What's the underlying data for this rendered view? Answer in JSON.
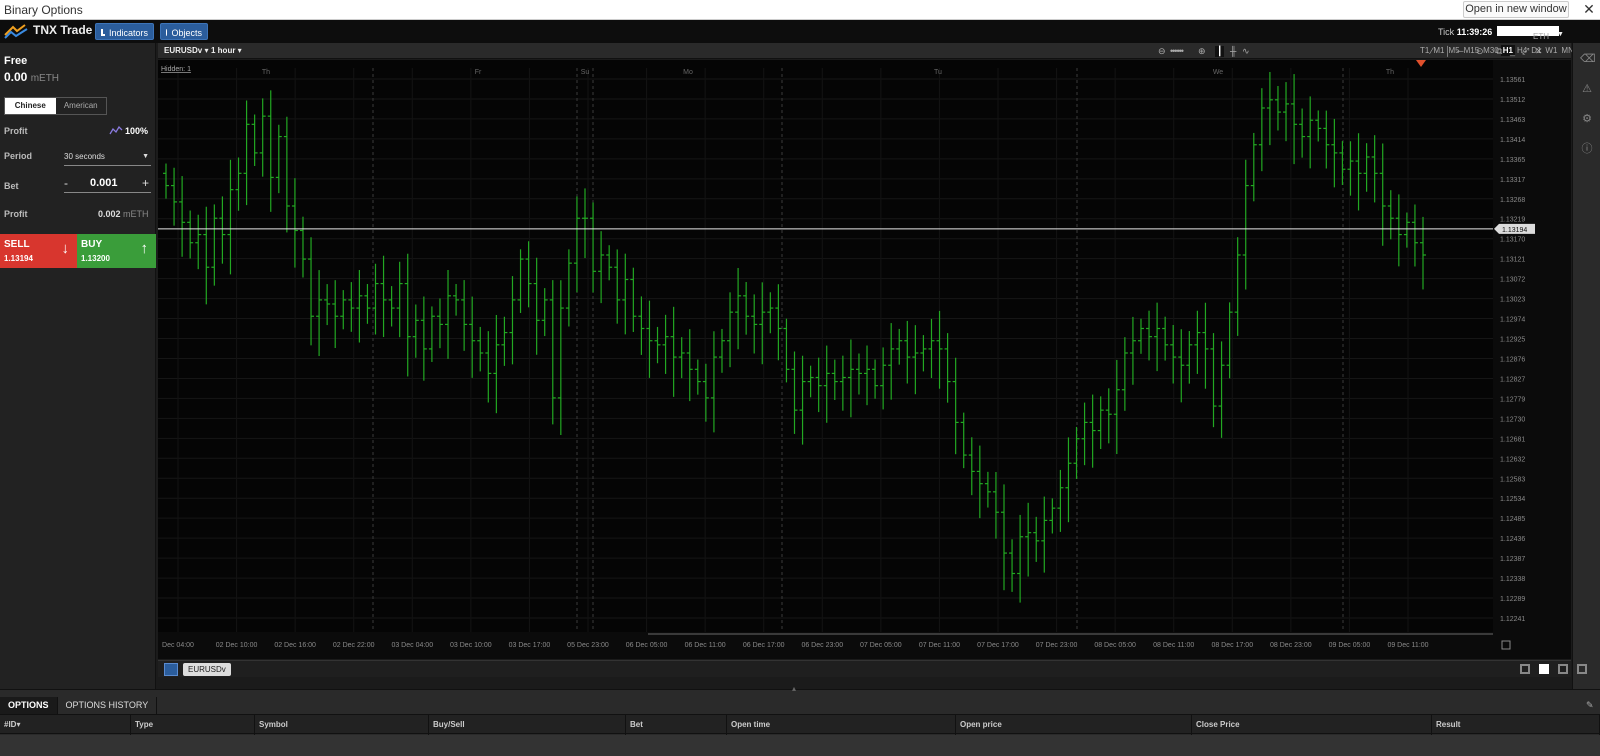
{
  "window": {
    "title": "Binary Options",
    "open_new_window": "Open in new window"
  },
  "header": {
    "brand": "TNX Trade",
    "indicators_label": "Indicators",
    "objects_label": "Objects",
    "tick_label": "Tick",
    "tick_time": "11:39:26",
    "account_currency": "ETH"
  },
  "left_panel": {
    "free_label": "Free",
    "free_value": "0.00",
    "free_unit": "mETH",
    "mode_tabs": [
      "Chinese",
      "American"
    ],
    "active_mode": "Chinese",
    "profit_label": "Profit",
    "profit_pct": "100%",
    "period_label": "Period",
    "period_value": "30 seconds",
    "bet_label": "Bet",
    "bet_minus": "-",
    "bet_value": "0.001",
    "bet_plus": "+",
    "profit2_label": "Profit",
    "profit2_value": "0.002",
    "profit2_unit": "mETH",
    "sell_label": "SELL",
    "sell_price": "1.13194",
    "buy_label": "BUY",
    "buy_price": "1.13200",
    "sell_color": "#d8362e",
    "buy_color": "#3a9d3a"
  },
  "chart_toolbar": {
    "symbol": "EURUSDv",
    "period": "1 hour",
    "timeframes": [
      "T1",
      "M1",
      "M5",
      "M15",
      "M30",
      "H1",
      "H4",
      "D1",
      "W1",
      "MN1"
    ],
    "active_timeframe": "H1"
  },
  "chart_data": {
    "type": "ohlc",
    "hidden_label": "Hidden: 1",
    "day_labels": [
      "Th",
      "Fr",
      "Su",
      "Mo",
      "Tu",
      "We",
      "Th"
    ],
    "x_tick_labels": [
      "Dec 04:00",
      "02 Dec 10:00",
      "02 Dec 16:00",
      "02 Dec 22:00",
      "03 Dec 04:00",
      "03 Dec 10:00",
      "03 Dec 17:00",
      "05 Dec 23:00",
      "06 Dec 05:00",
      "06 Dec 11:00",
      "06 Dec 17:00",
      "06 Dec 23:00",
      "07 Dec 05:00",
      "07 Dec 11:00",
      "07 Dec 17:00",
      "07 Dec 23:00",
      "08 Dec 05:00",
      "08 Dec 11:00",
      "08 Dec 17:00",
      "08 Dec 23:00",
      "09 Dec 05:00",
      "09 Dec 11:00"
    ],
    "y_tick_labels": [
      "1.13561",
      "1.13512",
      "1.13463",
      "1.13414",
      "1.13365",
      "1.13317",
      "1.13268",
      "1.13219",
      "1.13170",
      "1.13121",
      "1.13072",
      "1.13023",
      "1.12974",
      "1.12925",
      "1.12876",
      "1.12827",
      "1.12779",
      "1.12730",
      "1.12681",
      "1.12632",
      "1.12583",
      "1.12534",
      "1.12485",
      "1.12436",
      "1.12387",
      "1.12338",
      "1.12289",
      "1.12241"
    ],
    "ylim": [
      1.12241,
      1.13561
    ],
    "current_price": "1.13194",
    "bar_color": "#22a822",
    "price_line_color": "#e6e6e6",
    "closes": [
      1.133,
      1.1326,
      1.1321,
      1.1316,
      1.1318,
      1.131,
      1.1322,
      1.1318,
      1.1329,
      1.1333,
      1.1345,
      1.1338,
      1.1347,
      1.1332,
      1.1342,
      1.1325,
      1.1319,
      1.1312,
      1.1298,
      1.1302,
      1.1301,
      1.1298,
      1.1302,
      1.13,
      1.1303,
      1.13,
      1.1306,
      1.1302,
      1.13,
      1.1306,
      1.1293,
      1.1297,
      1.129,
      1.1298,
      1.1296,
      1.1303,
      1.1302,
      1.1296,
      1.1292,
      1.1289,
      1.1284,
      1.1291,
      1.1294,
      1.1302,
      1.1312,
      1.1306,
      1.1297,
      1.1302,
      1.1278,
      1.13,
      1.1311,
      1.1322,
      1.1322,
      1.1309,
      1.1313,
      1.131,
      1.1302,
      1.1307,
      1.1298,
      1.1295,
      1.1292,
      1.1291,
      1.1293,
      1.1288,
      1.1289,
      1.1285,
      1.1282,
      1.1278,
      1.1288,
      1.1292,
      1.1299,
      1.1303,
      1.1298,
      1.1296,
      1.1299,
      1.13,
      1.1295,
      1.1285,
      1.1275,
      1.1282,
      1.1283,
      1.1281,
      1.1284,
      1.1282,
      1.1283,
      1.1285,
      1.1284,
      1.1285,
      1.1281,
      1.1286,
      1.129,
      1.1292,
      1.1288,
      1.1289,
      1.129,
      1.1292,
      1.129,
      1.1282,
      1.1272,
      1.1264,
      1.126,
      1.1257,
      1.1255,
      1.125,
      1.124,
      1.1235,
      1.1244,
      1.1245,
      1.1243,
      1.1248,
      1.1251,
      1.1256,
      1.1262,
      1.1268,
      1.1272,
      1.127,
      1.1275,
      1.1274,
      1.128,
      1.1289,
      1.1292,
      1.1295,
      1.1293,
      1.1295,
      1.1291,
      1.1288,
      1.1286,
      1.1291,
      1.1294,
      1.129,
      1.1276,
      1.1286,
      1.1299,
      1.1313,
      1.133,
      1.134,
      1.1349,
      1.1351,
      1.1348,
      1.135,
      1.1345,
      1.1342,
      1.1346,
      1.1344,
      1.134,
      1.1338,
      1.1334,
      1.1336,
      1.1333,
      1.1337,
      1.1333,
      1.1325,
      1.1322,
      1.1318,
      1.1321,
      1.1316,
      1.1313
    ]
  },
  "symbol_tabs": [
    "EURUSDv"
  ],
  "bottom": {
    "tabs": [
      "OPTIONS",
      "OPTIONS HISTORY"
    ],
    "active_tab": "OPTIONS",
    "columns": [
      "#ID▾",
      "Type",
      "Symbol",
      "Buy/Sell",
      "Bet",
      "Open time",
      "Open price",
      "Close Price",
      "Result"
    ]
  }
}
